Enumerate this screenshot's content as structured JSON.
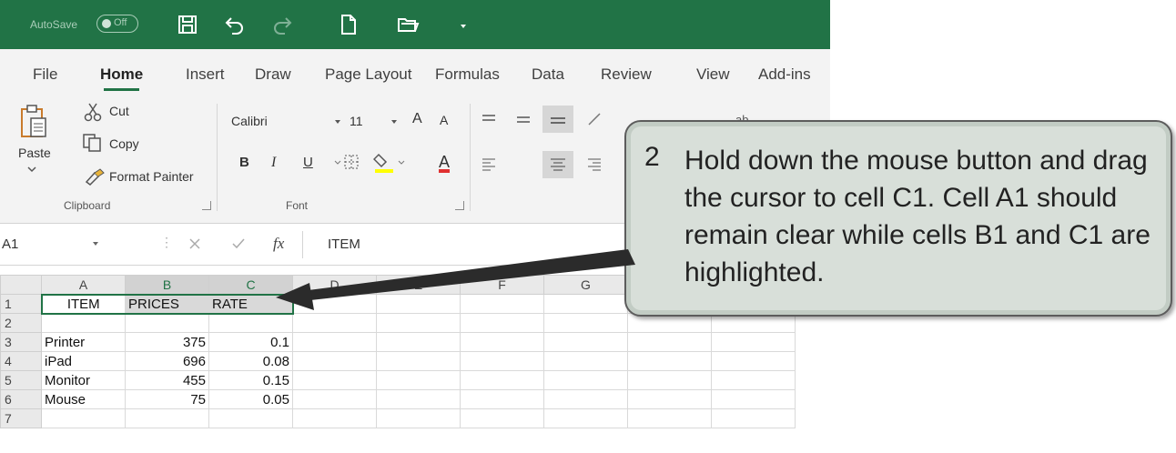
{
  "titlebar": {
    "autosave_label": "AutoSave",
    "autosave_state": "Off",
    "accent": "#217346"
  },
  "tabs": [
    "File",
    "Home",
    "Insert",
    "Draw",
    "Page Layout",
    "Formulas",
    "Data",
    "Review",
    "View",
    "Add-ins"
  ],
  "active_tab": "Home",
  "ribbon": {
    "paste_label": "Paste",
    "cut_label": "Cut",
    "copy_label": "Copy",
    "format_painter_label": "Format Painter",
    "clipboard_group": "Clipboard",
    "font_name": "Calibri",
    "font_size": "11",
    "font_group": "Font",
    "bold": "B",
    "italic": "I",
    "underline": "U",
    "font_color_letter": "A",
    "grow_font": "A",
    "shrink_font": "A",
    "wrap_text_partial": "ab"
  },
  "formula_bar": {
    "name_box": "A1",
    "fx": "fx",
    "formula": "ITEM"
  },
  "grid": {
    "columns": [
      "A",
      "B",
      "C",
      "D",
      "E",
      "F",
      "G",
      "H",
      "I"
    ],
    "rows": [
      {
        "num": "1",
        "cells": [
          "ITEM",
          "PRICES",
          "RATE"
        ]
      },
      {
        "num": "2",
        "cells": [
          "",
          "",
          ""
        ]
      },
      {
        "num": "3",
        "cells": [
          "Printer",
          "375",
          "0.1"
        ]
      },
      {
        "num": "4",
        "cells": [
          "iPad",
          "696",
          "0.08"
        ]
      },
      {
        "num": "5",
        "cells": [
          "Monitor",
          "455",
          "0.15"
        ]
      },
      {
        "num": "6",
        "cells": [
          "Mouse",
          "75",
          "0.05"
        ]
      },
      {
        "num": "7",
        "cells": [
          "",
          "",
          ""
        ]
      }
    ]
  },
  "callout": {
    "number": "2",
    "text": "Hold down the mouse button and drag the cursor to cell C1.  Cell A1 should remain clear while cells B1 and C1 are highlighted."
  }
}
